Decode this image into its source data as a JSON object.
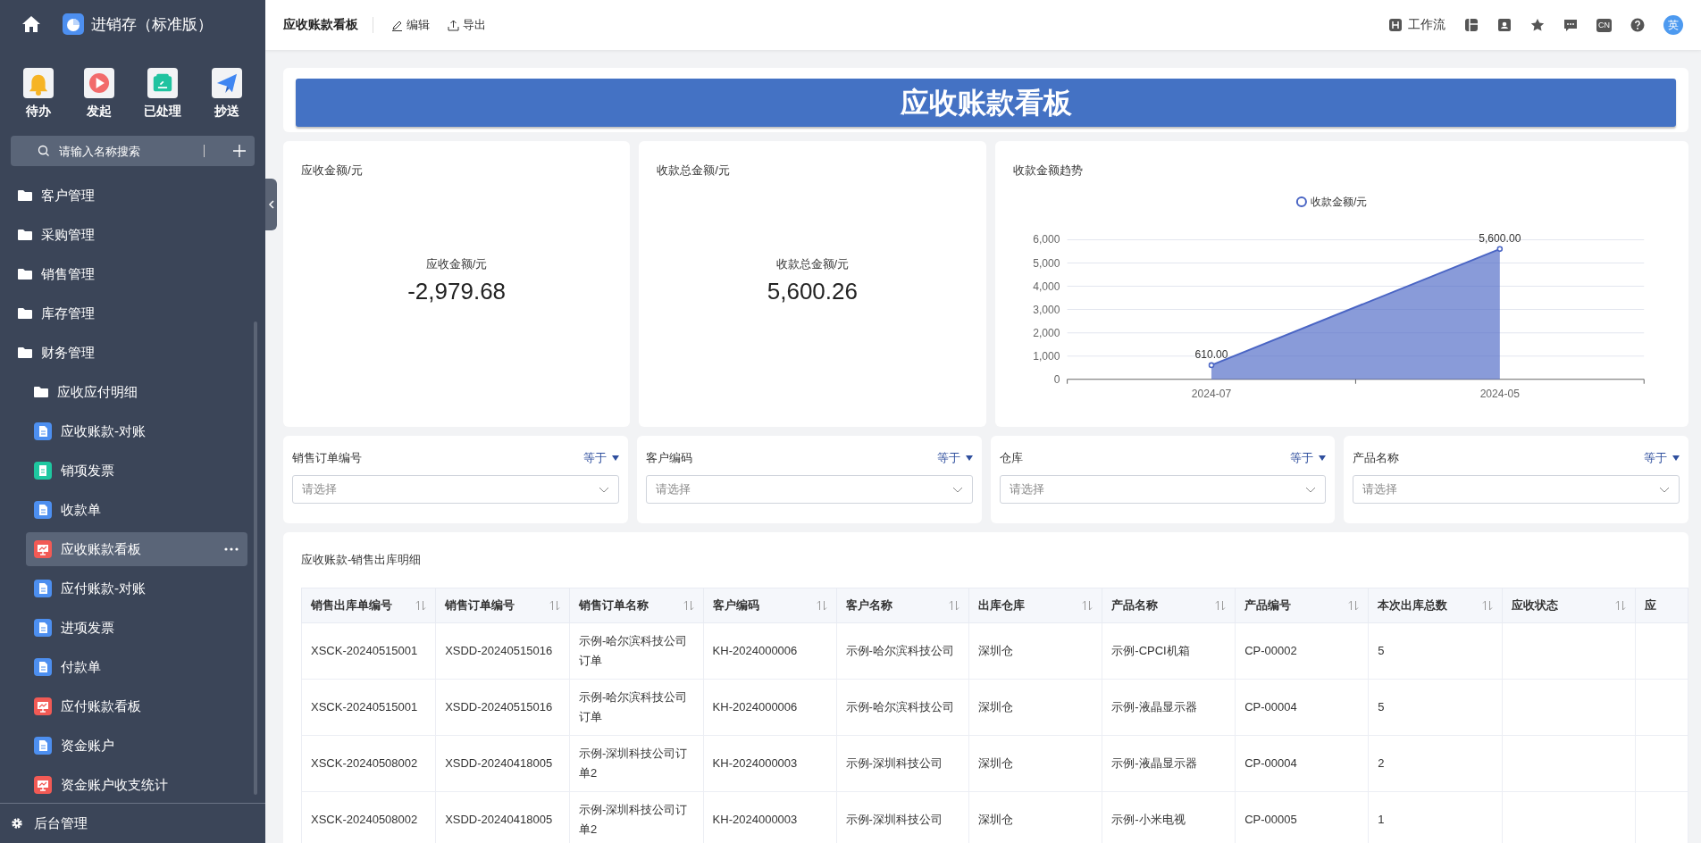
{
  "app": {
    "title": "进销存（标准版）"
  },
  "quick_actions": [
    {
      "label": "待办",
      "kind": "bell"
    },
    {
      "label": "发起",
      "kind": "play"
    },
    {
      "label": "已处理",
      "kind": "done"
    },
    {
      "label": "抄送",
      "kind": "send"
    }
  ],
  "sidebar": {
    "search": {
      "placeholder": "请输入名称搜索"
    },
    "items": [
      {
        "label": "客户管理",
        "kind": "folder",
        "selected": false
      },
      {
        "label": "采购管理",
        "kind": "folder",
        "selected": false
      },
      {
        "label": "销售管理",
        "kind": "folder",
        "selected": false
      },
      {
        "label": "库存管理",
        "kind": "folder",
        "selected": false
      },
      {
        "label": "财务管理",
        "kind": "folder",
        "selected": false,
        "children": [
          {
            "label": "应收应付明细",
            "kind": "folder",
            "selected": false
          },
          {
            "label": "应收账款-对账",
            "kind": "doc",
            "selected": false
          },
          {
            "label": "销项发票",
            "kind": "invoice",
            "selected": false
          },
          {
            "label": "收款单",
            "kind": "doc",
            "selected": false
          },
          {
            "label": "应收账款看板",
            "kind": "dashboard",
            "selected": true
          },
          {
            "label": "应付账款-对账",
            "kind": "doc",
            "selected": false
          },
          {
            "label": "进项发票",
            "kind": "doc",
            "selected": false
          },
          {
            "label": "付款单",
            "kind": "doc",
            "selected": false
          },
          {
            "label": "应付账款看板",
            "kind": "dashboard",
            "selected": false
          },
          {
            "label": "资金账户",
            "kind": "doc",
            "selected": false
          },
          {
            "label": "资金账户收支统计",
            "kind": "dashboard",
            "selected": false
          }
        ]
      }
    ],
    "footer": "后台管理"
  },
  "toolbar": {
    "title": "应收账款看板",
    "actions": [
      {
        "label": "编辑",
        "kind": "edit"
      },
      {
        "label": "导出",
        "kind": "export"
      }
    ],
    "right": [
      {
        "kind": "workflow",
        "label": "工作流"
      },
      {
        "kind": "layout"
      },
      {
        "kind": "contacts"
      },
      {
        "kind": "star"
      },
      {
        "kind": "message"
      },
      {
        "kind": "lang",
        "label": "CN"
      },
      {
        "kind": "help"
      },
      {
        "kind": "avatar",
        "label": "英"
      }
    ]
  },
  "banner": {
    "title": "应收账款看板"
  },
  "metrics": [
    {
      "title": "应收金额/元",
      "label": "应收金额/元",
      "value": "-2,979.68"
    },
    {
      "title": "收款总金额/元",
      "label": "收款总金额/元",
      "value": "5,600.26"
    }
  ],
  "trend": {
    "title": "收款金额趋势",
    "chart_data": {
      "type": "area",
      "categories": [
        "2024-07",
        "2024-05"
      ],
      "series": [
        {
          "name": "收款金额/元",
          "color": "#4a65c4",
          "values": [
            610,
            5600
          ]
        }
      ],
      "ylim": [
        0,
        6000
      ],
      "yticks": [
        0,
        {
          "value": 1000,
          "label": "1,000"
        },
        {
          "value": 2000,
          "label": "2,000"
        },
        {
          "value": 3000,
          "label": "3,000"
        },
        {
          "value": 4000,
          "label": "4,000"
        },
        {
          "value": 5000,
          "label": "5,000"
        },
        {
          "value": 6000,
          "label": "6,000"
        }
      ],
      "value_labels": [
        "610.00",
        "5,600.00"
      ],
      "grid": true
    }
  },
  "filters": [
    {
      "label": "销售订单编号",
      "operator": "等于",
      "placeholder": "请选择"
    },
    {
      "label": "客户编码",
      "operator": "等于",
      "placeholder": "请选择"
    },
    {
      "label": "仓库",
      "operator": "等于",
      "placeholder": "请选择"
    },
    {
      "label": "产品名称",
      "operator": "等于",
      "placeholder": "请选择"
    }
  ],
  "table": {
    "title": "应收账款-销售出库明细",
    "columns": [
      "销售出库单编号",
      "销售订单编号",
      "销售订单名称",
      "客户编码",
      "客户名称",
      "出库仓库",
      "产品名称",
      "产品编号",
      "本次出库总数",
      "应收状态",
      "应"
    ],
    "rows": [
      [
        "XSCK-20240515001",
        "XSDD-20240515016",
        "示例-哈尔滨科技公司订单",
        "KH-2024000006",
        "示例-哈尔滨科技公司",
        "深圳仓",
        "示例-CPCI机箱",
        "CP-00002",
        "5",
        "",
        ""
      ],
      [
        "XSCK-20240515001",
        "XSDD-20240515016",
        "示例-哈尔滨科技公司订单",
        "KH-2024000006",
        "示例-哈尔滨科技公司",
        "深圳仓",
        "示例-液晶显示器",
        "CP-00004",
        "5",
        "",
        ""
      ],
      [
        "XSCK-20240508002",
        "XSDD-20240418005",
        "示例-深圳科技公司订单2",
        "KH-2024000003",
        "示例-深圳科技公司",
        "深圳仓",
        "示例-液晶显示器",
        "CP-00004",
        "2",
        "",
        ""
      ],
      [
        "XSCK-20240508002",
        "XSDD-20240418005",
        "示例-深圳科技公司订单2",
        "KH-2024000003",
        "示例-深圳科技公司",
        "深圳仓",
        "示例-小米电视",
        "CP-00005",
        "1",
        "",
        ""
      ]
    ]
  }
}
